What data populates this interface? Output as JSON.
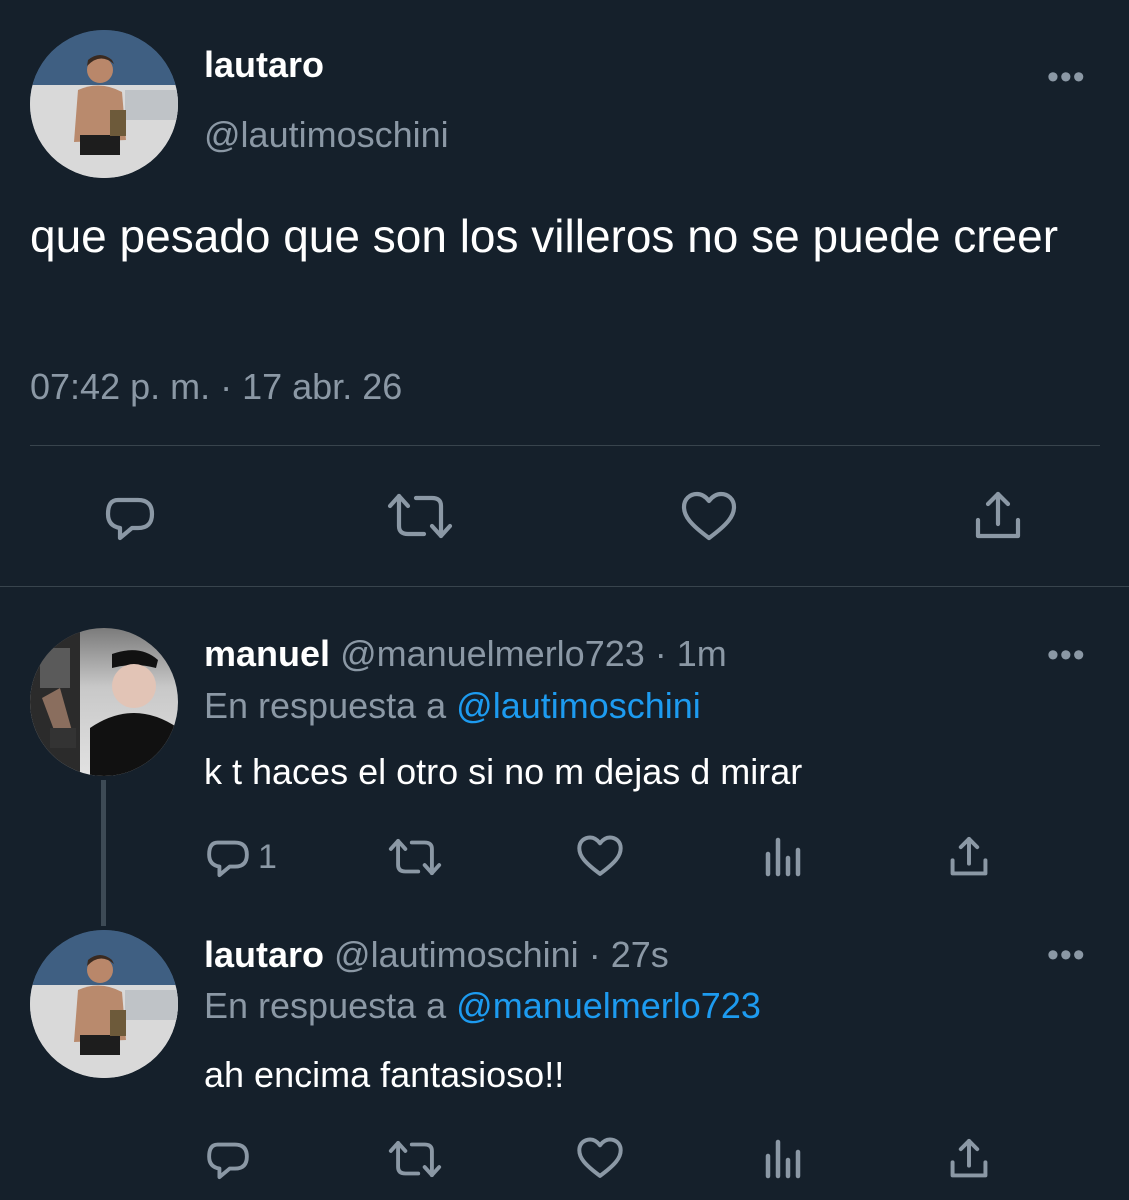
{
  "main_tweet": {
    "display_name": "lautaro",
    "handle": "@lautimoschini",
    "text": "que pesado que son los villeros no se puede creer",
    "timestamp": "07:42 p. m. · 17 abr. 26",
    "more_label": "•••"
  },
  "replies": [
    {
      "display_name": "manuel",
      "handle": "@manuelmerlo723",
      "time": "· 1m",
      "reply_prefix": "En respuesta a",
      "reply_to": "@lautimoschini",
      "text": "k t haces el otro si no m dejas d mirar",
      "reply_count": "1",
      "more_label": "•••"
    },
    {
      "display_name": "lautaro",
      "handle": "@lautimoschini",
      "time": "· 27s",
      "reply_prefix": "En respuesta a",
      "reply_to": "@manuelmerlo723",
      "text": "ah encima fantasioso!!",
      "reply_count": "",
      "more_label": "•••"
    }
  ],
  "colors": {
    "background": "#15202b",
    "muted": "#8b98a5",
    "link": "#1d9bf0",
    "divider": "#38444d"
  },
  "icons": [
    "reply-icon",
    "retweet-icon",
    "like-icon",
    "views-icon",
    "share-icon",
    "more-icon"
  ]
}
